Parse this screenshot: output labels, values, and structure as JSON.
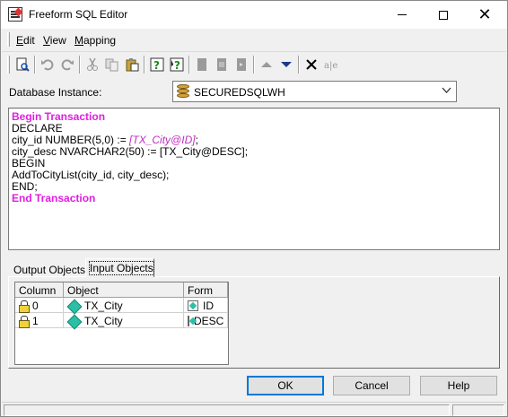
{
  "window": {
    "title": "Freeform SQL Editor",
    "minimize_label": "",
    "close_label": "✕"
  },
  "menu": {
    "items": [
      {
        "label": "Edit",
        "mnemonic": "E"
      },
      {
        "label": "View",
        "mnemonic": "V"
      },
      {
        "label": "Mapping",
        "mnemonic": "M"
      }
    ]
  },
  "toolbar": {
    "icons": [
      "properties-icon",
      "undo-icon",
      "redo-icon",
      "cut-icon",
      "copy-icon",
      "paste-icon",
      "help-icon",
      "whats-this-icon",
      "insert-row-icon",
      "delete-row-icon",
      "refresh-icon",
      "move-up-icon",
      "move-down-icon",
      "clear-icon",
      "rename-icon"
    ]
  },
  "database": {
    "label": "Database Instance:",
    "selected": "SECUREDSQLWH"
  },
  "editor": {
    "lines": [
      {
        "text": "Begin Transaction",
        "kind": "keyword"
      },
      {
        "text": "DECLARE",
        "kind": "plain"
      },
      {
        "text": "city_id NUMBER(5,0) := ",
        "kind": "plain",
        "placeholder": "[TX_City@ID]",
        "suffix": ";"
      },
      {
        "text": "city_desc NVARCHAR2(50) := [TX_City@DESC];",
        "kind": "plain"
      },
      {
        "text": "BEGIN",
        "kind": "plain"
      },
      {
        "text": "AddToCityList(city_id, city_desc);",
        "kind": "plain"
      },
      {
        "text": "END;",
        "kind": "plain"
      },
      {
        "text": "End Transaction",
        "kind": "keyword"
      }
    ]
  },
  "tabs": {
    "output": "Output Objects",
    "input": "Input Objects"
  },
  "grid": {
    "headers": [
      "Column",
      "Object",
      "Form"
    ],
    "rows": [
      {
        "column": "0",
        "object": "TX_City",
        "form": "ID"
      },
      {
        "column": "1",
        "object": "TX_City",
        "form": "DESC"
      }
    ]
  },
  "buttons": {
    "ok": "OK",
    "cancel": "Cancel",
    "help": "Help"
  },
  "colors": {
    "keyword": "#e01ee0",
    "placeholder": "#c02ec0",
    "accent": "#0078d7"
  }
}
